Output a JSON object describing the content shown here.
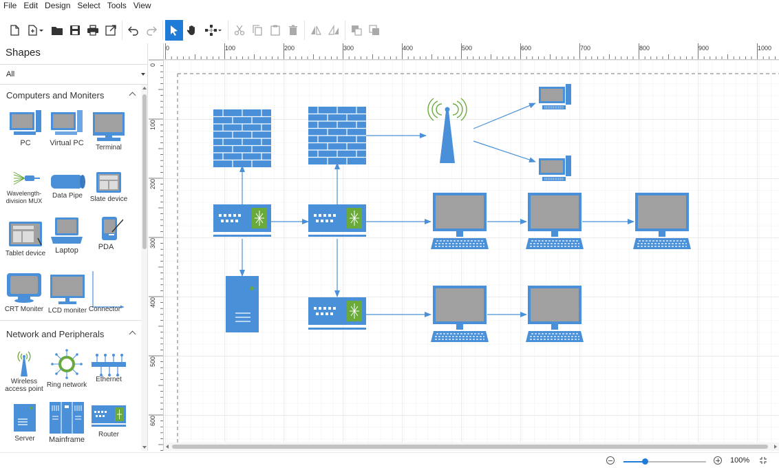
{
  "menu": [
    "File",
    "Edit",
    "Design",
    "Select",
    "Tools",
    "View"
  ],
  "toolbar": {
    "icons": [
      "new-file-icon",
      "open-template-icon",
      "open-folder-icon",
      "save-icon",
      "print-icon",
      "export-icon",
      "undo-icon",
      "redo-icon",
      "select-tool-icon",
      "pan-tool-icon",
      "connector-tool-icon",
      "cut-icon",
      "copy-icon",
      "paste-icon",
      "delete-icon",
      "flip-horizontal-icon",
      "flip-vertical-icon",
      "send-to-back-icon",
      "bring-to-front-icon"
    ]
  },
  "panel": {
    "title": "Shapes",
    "filter_value": "All",
    "sections": [
      {
        "title": "Computers and Moniters",
        "shapes": [
          "PC",
          "Virtual PC",
          "Terminal",
          "Wavelength-division MUX",
          "Data Pipe",
          "Slate device",
          "Tablet device",
          "Laptop",
          "PDA",
          "CRT Moniter",
          "LCD moniter",
          "Connector"
        ]
      },
      {
        "title": "Network and Peripherals",
        "shapes": [
          "Wireless access point",
          "Ring network",
          "Ethernet",
          "Server",
          "Mainframe",
          "Router"
        ]
      }
    ]
  },
  "rulers": {
    "horizontal": [
      "0",
      "100",
      "200",
      "300",
      "400",
      "500",
      "600",
      "700",
      "800",
      "900",
      "1000"
    ],
    "vertical": [
      "0",
      "100",
      "200",
      "300",
      "400",
      "500",
      "600"
    ]
  },
  "status": {
    "zoom_level": "100%",
    "zoom_fraction": 0.27
  },
  "colors": {
    "shape_blue": "#4a90d9",
    "screen_gray": "#a0a0a0",
    "accent_green": "#6aaa3a",
    "selected_tool": "#1e7bd6"
  }
}
